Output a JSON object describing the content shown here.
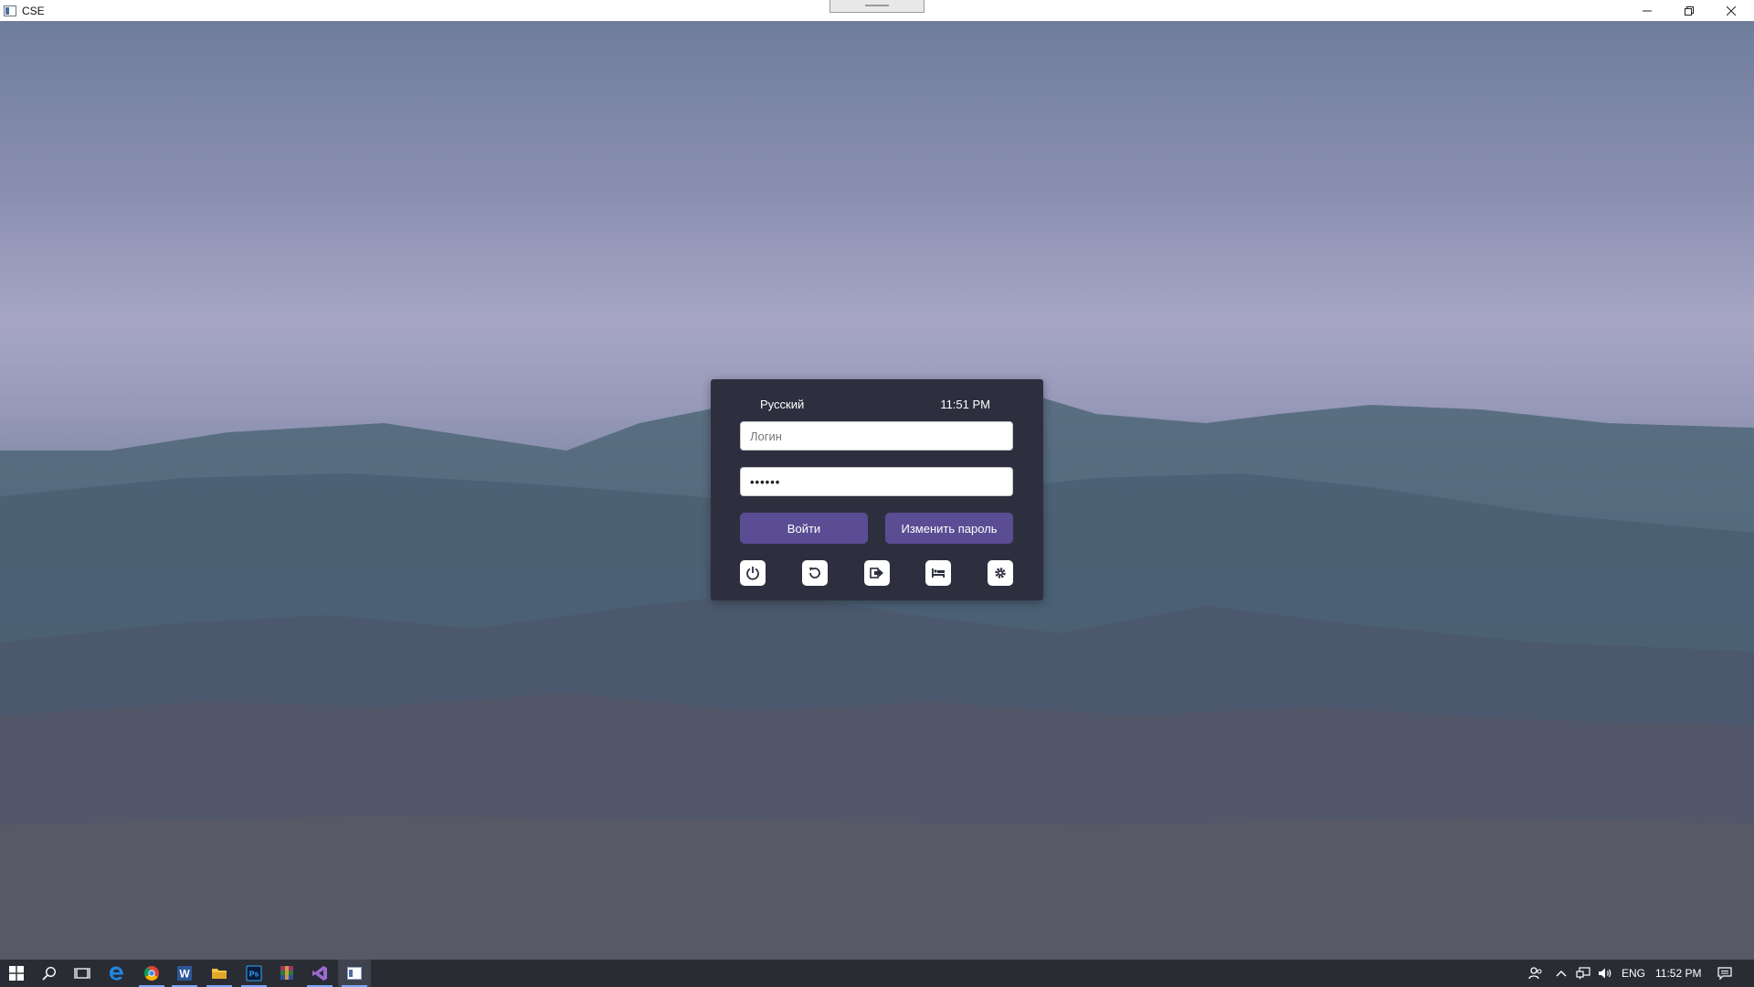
{
  "window": {
    "title": "CSE",
    "icon": "app-window-icon",
    "controls": [
      "minimize-icon",
      "restore-icon",
      "close-icon"
    ]
  },
  "login_panel": {
    "language": "Русский",
    "time": "11:51 PM",
    "login_placeholder": "Логин",
    "login_value": "",
    "password_value": "••••••",
    "login_button": "Войти",
    "change_password_button": "Изменить пароль",
    "tool_icons": [
      "power-icon",
      "restart-icon",
      "logout-icon",
      "sleep-icon",
      "settings-icon"
    ]
  },
  "taskbar": {
    "pinned": [
      "start-icon",
      "search-icon",
      "task-view-icon",
      "edge-icon",
      "chrome-icon",
      "word-icon",
      "file-explorer-icon",
      "photoshop-icon",
      "winrar-icon",
      "visual-studio-icon",
      "cse-app-icon"
    ],
    "tray": {
      "language": "ENG",
      "time": "11:52 PM",
      "icons": [
        "people-icon",
        "chevron-up-icon",
        "network-icon",
        "volume-icon",
        "notifications-icon"
      ]
    }
  },
  "colors": {
    "panel_bg": "#2d2f3f",
    "button_bg": "#5a4d93",
    "taskbar_bg": "#2a2c33"
  }
}
